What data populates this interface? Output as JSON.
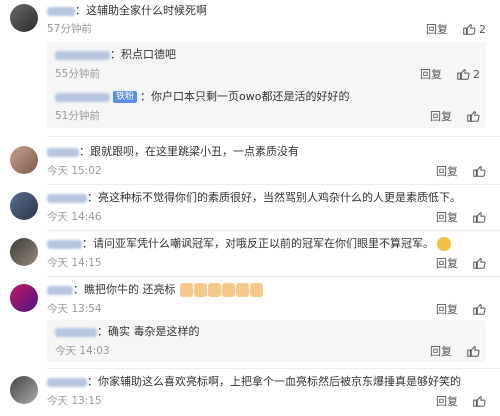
{
  "actions": {
    "reply": "回复"
  },
  "comments": [
    {
      "text": "：这辅助全家什么时候死啊",
      "time": "57分钟前",
      "likes": "2"
    },
    {
      "text": "：积点口德吧",
      "time": "55分钟前",
      "likes": "2"
    },
    {
      "text": "：你户口本只剩一页owo都还是活的好好的",
      "badge": "铁粉",
      "time": "51分钟前"
    },
    {
      "text": "：跟就跟呗，在这里跳梁小丑，一点素质没有",
      "time": "今天 15:02"
    },
    {
      "text": "：亮这种标不觉得你们的素质很好，当然骂别人鸡杂什么的人更是素质低下。",
      "time": "今天 14:46"
    },
    {
      "text": "：请问亚军凭什么嘲讽冠军，对哦反正以前的冠军在你们眼里不算冠军。",
      "time": "今天 14:15"
    },
    {
      "text": "：瞧把你牛的 还亮标",
      "time": "今天 13:54"
    },
    {
      "text": "：确实  毒杂是这样的",
      "time": "今天 14:03"
    },
    {
      "text": "：你家辅助这么喜欢亮标啊，上把拿个一血亮标然后被京东爆捶真是够好笑的",
      "time": "今天 13:15"
    }
  ],
  "icons": {
    "thumb": "thumbs-up-icon",
    "emoji_smile": "grinning-emoji-icon",
    "emoji_hand": "thumbs-down-emoji-icon"
  }
}
